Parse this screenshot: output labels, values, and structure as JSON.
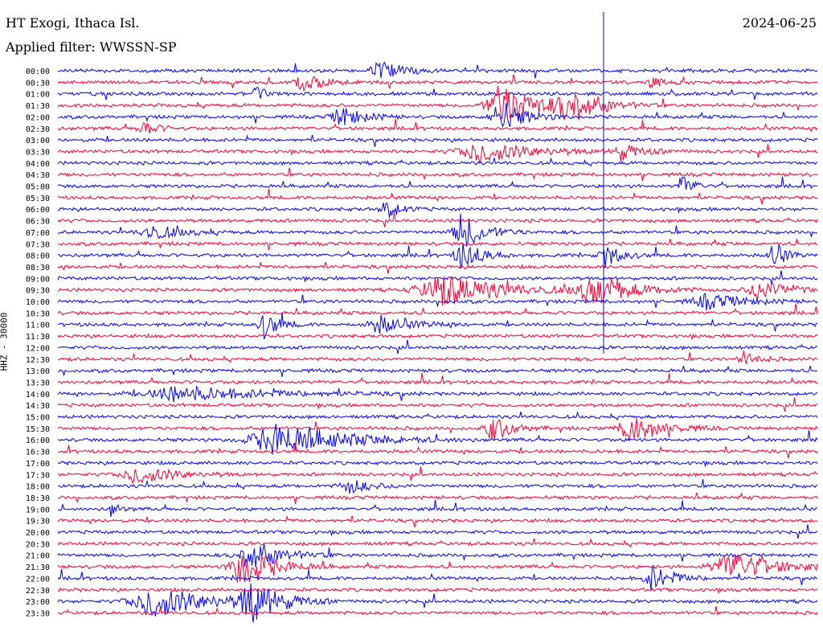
{
  "header": {
    "station": "HT Exogi, Ithaca Isl.",
    "filter": "Applied filter: WWSSN-SP",
    "date": "2024-06-25"
  },
  "chart_data": {
    "type": "line",
    "title": "HT Exogi, Ithaca Isl.",
    "subtitle": "Applied filter: WWSSN-SP",
    "date": "2024-06-25",
    "ylabel": "HHZ - 30000",
    "row_labels": [
      "00:00",
      "00:30",
      "01:00",
      "01:30",
      "02:00",
      "02:30",
      "03:00",
      "03:30",
      "04:00",
      "04:30",
      "05:00",
      "05:30",
      "06:00",
      "06:30",
      "07:00",
      "07:30",
      "08:00",
      "08:30",
      "09:00",
      "09:30",
      "10:00",
      "10:30",
      "11:00",
      "11:30",
      "12:00",
      "12:30",
      "13:00",
      "13:30",
      "14:00",
      "14:30",
      "15:00",
      "15:30",
      "16:00",
      "16:30",
      "17:00",
      "17:30",
      "18:00",
      "18:30",
      "19:00",
      "19:30",
      "20:00",
      "20:30",
      "21:00",
      "21:30",
      "22:00",
      "22:30",
      "23:00",
      "23:30"
    ],
    "colors": [
      "#0000ff",
      "#ff0033"
    ],
    "events": [
      {
        "row": 0,
        "pos": 0.42,
        "amp": 14,
        "width": 0.06
      },
      {
        "row": 1,
        "pos": 0.32,
        "amp": 12,
        "width": 0.06
      },
      {
        "row": 1,
        "pos": 0.78,
        "amp": 8,
        "width": 0.03
      },
      {
        "row": 2,
        "pos": 0.26,
        "amp": 16,
        "width": 0.02
      },
      {
        "row": 3,
        "pos": 0.58,
        "amp": 28,
        "width": 0.1
      },
      {
        "row": 3,
        "pos": 0.67,
        "amp": 22,
        "width": 0.08
      },
      {
        "row": 4,
        "pos": 0.37,
        "amp": 14,
        "width": 0.06
      },
      {
        "row": 4,
        "pos": 0.58,
        "amp": 24,
        "width": 0.06
      },
      {
        "row": 5,
        "pos": 0.11,
        "amp": 10,
        "width": 0.04
      },
      {
        "row": 7,
        "pos": 0.55,
        "amp": 14,
        "width": 0.14
      },
      {
        "row": 7,
        "pos": 0.74,
        "amp": 10,
        "width": 0.06
      },
      {
        "row": 10,
        "pos": 0.82,
        "amp": 16,
        "width": 0.03
      },
      {
        "row": 12,
        "pos": 0.43,
        "amp": 12,
        "width": 0.04
      },
      {
        "row": 14,
        "pos": 0.53,
        "amp": 24,
        "width": 0.06
      },
      {
        "row": 14,
        "pos": 0.12,
        "amp": 10,
        "width": 0.08
      },
      {
        "row": 16,
        "pos": 0.53,
        "amp": 20,
        "width": 0.05
      },
      {
        "row": 16,
        "pos": 0.72,
        "amp": 16,
        "width": 0.04
      },
      {
        "row": 16,
        "pos": 0.94,
        "amp": 20,
        "width": 0.03
      },
      {
        "row": 19,
        "pos": 0.5,
        "amp": 22,
        "width": 0.16
      },
      {
        "row": 19,
        "pos": 0.7,
        "amp": 22,
        "width": 0.1
      },
      {
        "row": 19,
        "pos": 0.92,
        "amp": 14,
        "width": 0.08
      },
      {
        "row": 20,
        "pos": 0.85,
        "amp": 10,
        "width": 0.1
      },
      {
        "row": 22,
        "pos": 0.27,
        "amp": 18,
        "width": 0.04
      },
      {
        "row": 22,
        "pos": 0.42,
        "amp": 12,
        "width": 0.08
      },
      {
        "row": 25,
        "pos": 0.9,
        "amp": 10,
        "width": 0.04
      },
      {
        "row": 28,
        "pos": 0.15,
        "amp": 10,
        "width": 0.22
      },
      {
        "row": 31,
        "pos": 0.57,
        "amp": 18,
        "width": 0.05
      },
      {
        "row": 31,
        "pos": 0.75,
        "amp": 20,
        "width": 0.08
      },
      {
        "row": 32,
        "pos": 0.28,
        "amp": 22,
        "width": 0.18
      },
      {
        "row": 35,
        "pos": 0.1,
        "amp": 12,
        "width": 0.1
      },
      {
        "row": 36,
        "pos": 0.38,
        "amp": 10,
        "width": 0.06
      },
      {
        "row": 38,
        "pos": 0.07,
        "amp": 10,
        "width": 0.02
      },
      {
        "row": 42,
        "pos": 0.25,
        "amp": 22,
        "width": 0.08
      },
      {
        "row": 43,
        "pos": 0.24,
        "amp": 30,
        "width": 0.08
      },
      {
        "row": 43,
        "pos": 0.88,
        "amp": 20,
        "width": 0.12
      },
      {
        "row": 44,
        "pos": 0.78,
        "amp": 16,
        "width": 0.06
      },
      {
        "row": 46,
        "pos": 0.12,
        "amp": 22,
        "width": 0.14
      },
      {
        "row": 46,
        "pos": 0.25,
        "amp": 28,
        "width": 0.08
      }
    ]
  }
}
